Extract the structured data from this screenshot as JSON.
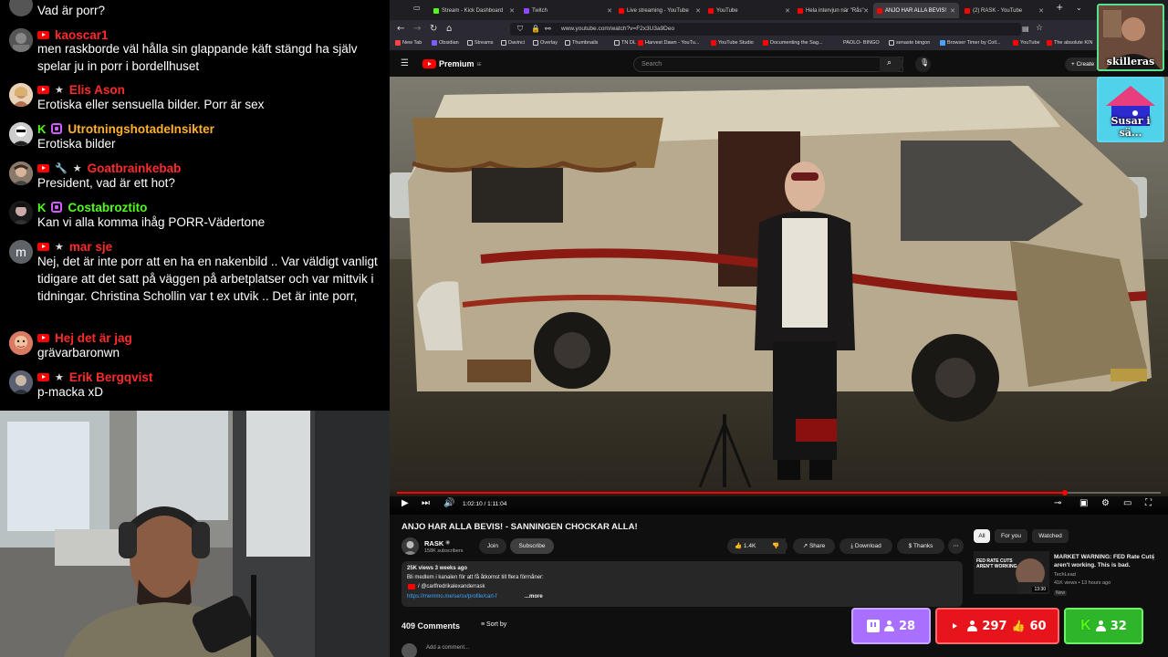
{
  "colors": {
    "youtube_red": "#ff0000",
    "kick_green": "#53fc18",
    "twitch_purple": "#9146ff",
    "sub_pink": "#d35cff",
    "overlay_border": "#5adf8a"
  },
  "chat": {
    "messages": [
      {
        "user": "",
        "user_color": "#ffffff",
        "text": "Vad är porr?"
      },
      {
        "user": "kaoscar1",
        "user_color": "#ff2b2b",
        "platform": "youtube",
        "text": "men raskborde väl hålla sin glappande käft stängd ha själv spelar ju in porr i bordellhuset"
      },
      {
        "user": "Elis Ason",
        "user_color": "#ff2b2b",
        "platform": "youtube",
        "text": "Erotiska eller sensuella bilder. Porr är sex"
      },
      {
        "user": "UtrotningshotadeInsikter",
        "user_color": "#ffb02e",
        "platform": "kick",
        "text": "Erotiska bilder"
      },
      {
        "user": "Goatbrainkebab",
        "user_color": "#ff2b2b",
        "platform": "youtube",
        "text": "President, vad är ett hot?"
      },
      {
        "user": "Costabroztito",
        "user_color": "#53fc18",
        "platform": "kick",
        "text": "Kan vi alla komma ihåg PORR-Vädertone"
      },
      {
        "user": "mar sje",
        "user_color": "#ff2b2b",
        "platform": "youtube",
        "avatar_letter": "m",
        "text": "Nej, det är inte porr att en ha en nakenbild .. Var väldigt vanligt tidigare att det satt på väggen på arbetplatser och var mittvik i tidningar. Christina Schollin var t ex utvik .. Det är inte porr,"
      },
      {
        "user": "Hej det är jag",
        "user_color": "#ff2b2b",
        "platform": "youtube",
        "text": "grävarbaronwn"
      },
      {
        "user": "Erik Bergqvist",
        "user_color": "#ff2b2b",
        "platform": "youtube",
        "text": "p-macka xD"
      }
    ]
  },
  "browser": {
    "tabs": [
      {
        "label": "Stream - Kick Dashboard",
        "color": "#53fc18"
      },
      {
        "label": "Twitch",
        "color": "#9146ff"
      },
      {
        "label": "Live streaming - YouTube",
        "color": "#ff0000"
      },
      {
        "label": "YouTube",
        "color": "#ff0000"
      },
      {
        "label": "Hela intervjun när \"Rås\"",
        "color": "#ff0000"
      },
      {
        "label": "ANJO HAR ALLA BEVIS!",
        "color": "#ff0000"
      },
      {
        "label": "(2) RASK - YouTube",
        "color": "#ff0000"
      }
    ],
    "url": "www.youtube.com/watch?v=F2x3U3a9Deo",
    "bookmarks": [
      "New Tab",
      "Obsidian",
      "Streams",
      "Davinci",
      "Overlay",
      "Thumbnails",
      "TN DL",
      "Harvest Dawn - YouTu...",
      "YouTube Studio",
      "Documenting the Sag...",
      "PAOLO- BINGO",
      "senaste bingon",
      "Browser Timer by Coll...",
      "YouTube",
      "The absolute KIN"
    ]
  },
  "youtube": {
    "logo_text": "Premium",
    "logo_sup": "SE",
    "search_placeholder": "Search",
    "create_label": "+ Create",
    "player": {
      "current_time": "1:02:10",
      "duration": "1:11:04",
      "progress": 0.875,
      "time_display": "1:02:10 / 1:11:04"
    },
    "video_title": "ANJO HAR ALLA BEVIS! - SANNINGEN CHOCKAR ALLA!",
    "channel": {
      "name": "RASK",
      "subscribers": "158K subscribers"
    },
    "buttons": {
      "join": "Join",
      "subscribe": "Subscribe",
      "likes": "1.4K",
      "share": "Share",
      "download": "Download",
      "thanks": "Thanks"
    },
    "description": {
      "meta": "25K views  3 weeks ago",
      "line1": "Bli medlem i kanalen för att få åtkomst till flera förmåner:",
      "line2": "/ @carlfredrikalexanderrask",
      "line3": "https://memmo.me/se/sv/profile/carl-f",
      "more": "...more"
    },
    "comments": {
      "count_label": "409 Comments",
      "sort_label": "Sort by",
      "add_placeholder": "Add a comment..."
    },
    "chips": [
      "All",
      "For you",
      "Watched"
    ],
    "recommended": [
      {
        "title": "MARKET WARNING: FED Rate Cuts aren't working. This is bad.",
        "channel": "TechLead",
        "meta": "41K views • 13 hours ago",
        "badge": "New",
        "duration": "13:30",
        "thumb_text": "FED RATE CUTS AREN'T WORKING"
      }
    ]
  },
  "overlays": {
    "cams": [
      {
        "label": "skilleras"
      },
      {
        "label": "Susar i sä..."
      }
    ],
    "viewers": {
      "twitch": "28",
      "youtube": "297",
      "youtube_likes": "60",
      "kick": "32"
    }
  }
}
